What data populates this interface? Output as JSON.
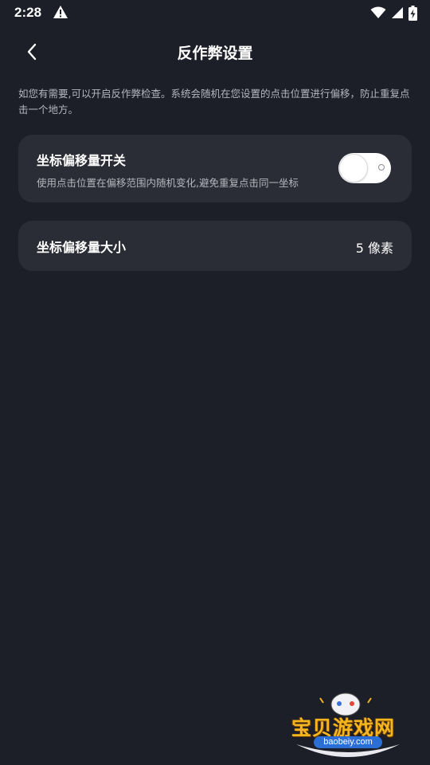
{
  "status_bar": {
    "time": "2:28",
    "icons": [
      "warning-icon",
      "wifi-icon",
      "signal-icon",
      "battery-charging-icon"
    ]
  },
  "header": {
    "title": "反作弊设置",
    "back_icon": "chevron-left-icon"
  },
  "description": "如您有需要,可以开启反作弊检查。系统会随机在您设置的点击位置进行偏移，防止重复点击一个地方。",
  "offset_switch": {
    "title": "坐标偏移量开关",
    "subtitle": "使用点击位置在偏移范围内随机变化,避免重复点击同一坐标",
    "enabled": false
  },
  "offset_size": {
    "title": "坐标偏移量大小",
    "value": "5 像素"
  },
  "watermark": {
    "brand": "宝贝游戏网",
    "url": "baobeiy.com"
  },
  "colors": {
    "background": "#1d1f28",
    "card": "#2b2d36",
    "text_primary": "#ffffff",
    "text_secondary": "#b4b6bf"
  }
}
